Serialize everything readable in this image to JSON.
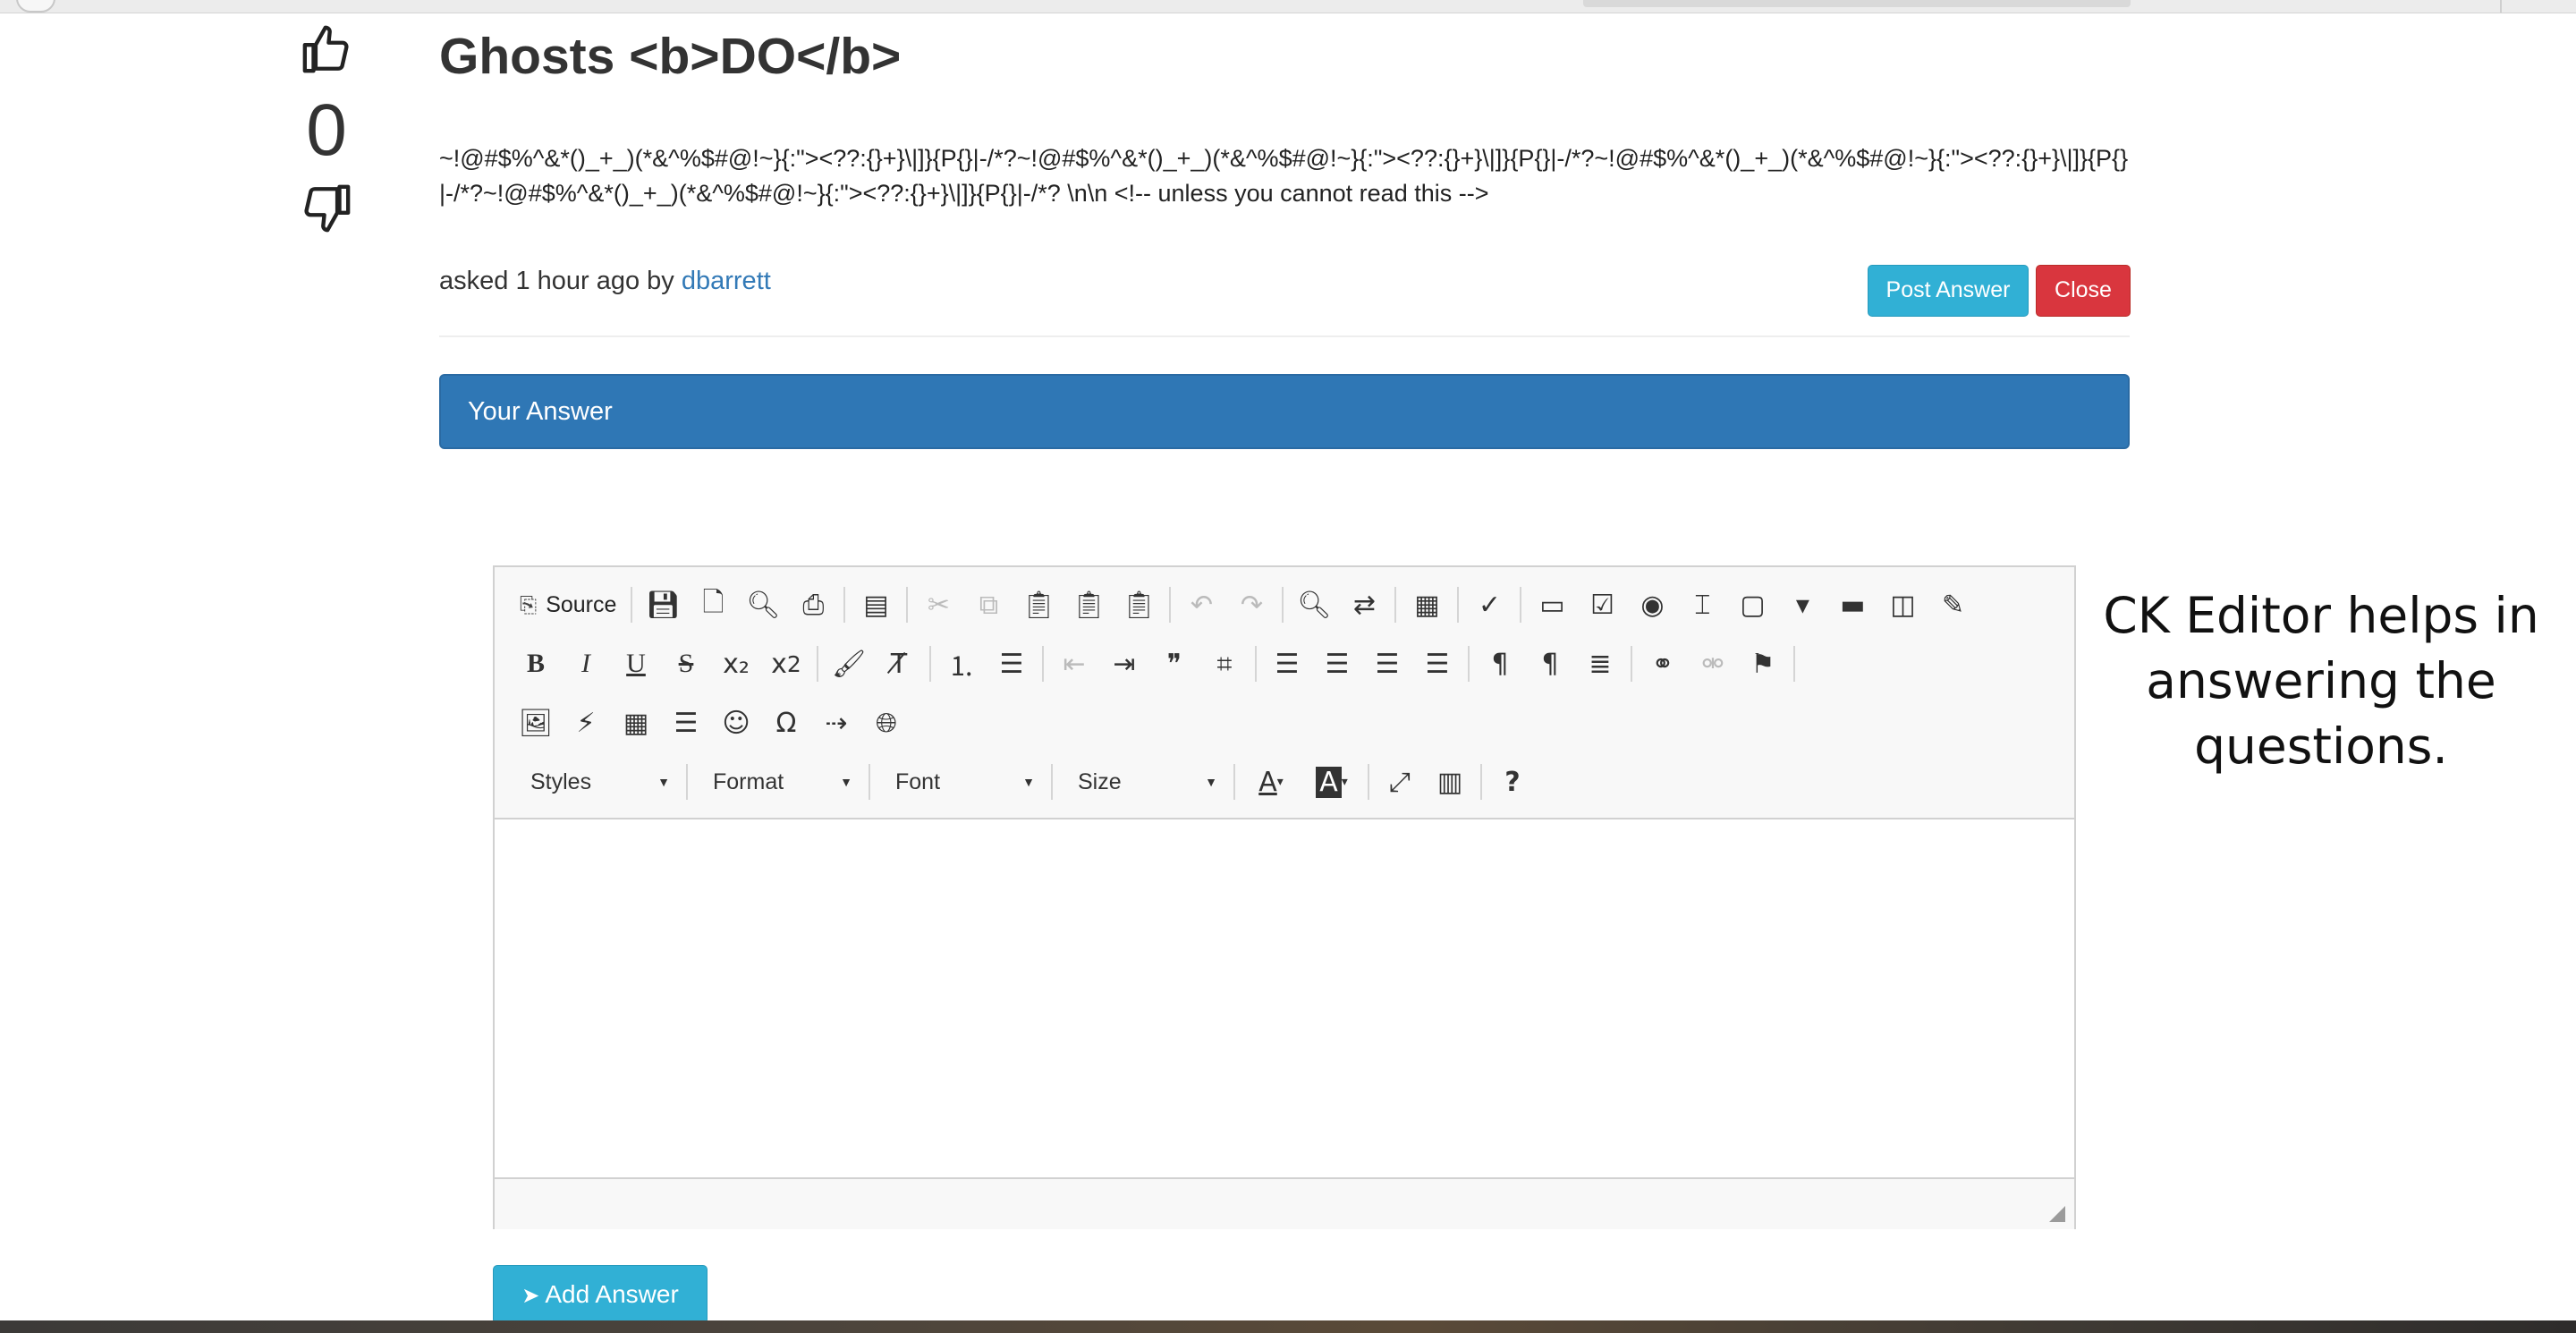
{
  "question": {
    "title": "Ghosts <b>DO</b>",
    "body": "~!@#$%^&*()_+_)(*&^%$#@!~}{:\"><??:{}+}\\|]}{P{}|-/*?~!@#$%^&*()_+_)(*&^%$#@!~}{:\"><??:{}+}\\|]}{P{}|-/*?~!@#$%^&*()_+_)(*&^%$#@!~}{:\"><??:{}+}\\|]}{P{}|-/*?~!@#$%^&*()_+_)(*&^%$#@!~}{:\"><??:{}+}\\|]}{P{}|-/*? \\n\\n <!-- unless you cannot read this -->",
    "votes": "0",
    "asked_prefix": "asked 1 hour ago by ",
    "author": "dbarrett"
  },
  "actions": {
    "post_answer": "Post Answer",
    "close": "Close",
    "add_answer": "Add Answer"
  },
  "answer_panel": {
    "heading": "Your Answer"
  },
  "editor": {
    "source_label": "Source",
    "combos": {
      "styles": "Styles",
      "format": "Format",
      "font": "Font",
      "size": "Size"
    },
    "superscript": "2",
    "content": ""
  },
  "annotation": {
    "text": "CK Editor helps in answering the questions."
  },
  "colors": {
    "link": "#337ab7",
    "info_button": "#31b0d5",
    "danger_button": "#d9363e",
    "panel_primary": "#2f77b5"
  }
}
